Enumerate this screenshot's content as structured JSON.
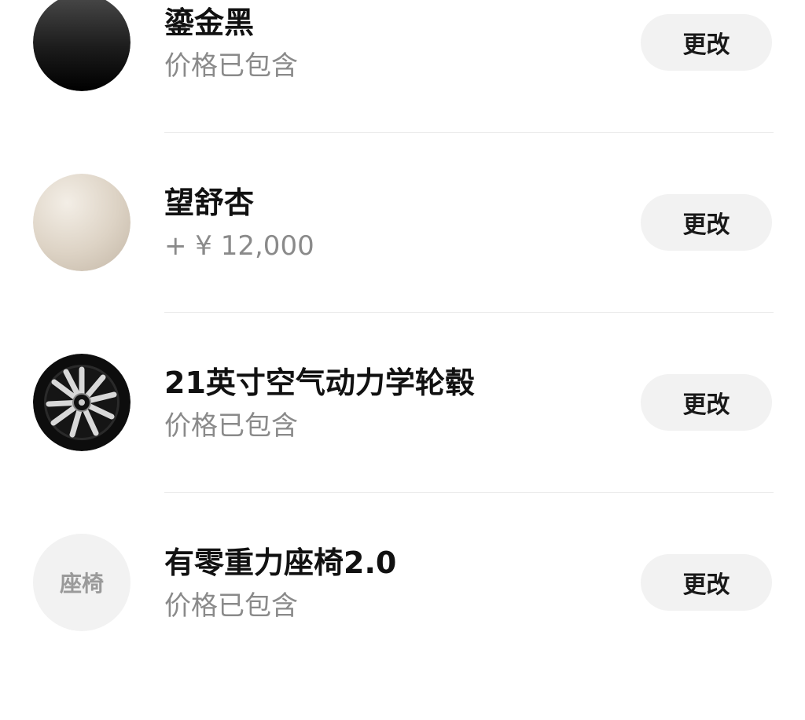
{
  "options": [
    {
      "swatch": "black-color-swatch",
      "title": "鎏金黑",
      "subtitle": "价格已包含",
      "button_label": "更改"
    },
    {
      "swatch": "apricot-color-swatch",
      "title": "望舒杏",
      "subtitle": "+ ¥ 12,000",
      "button_label": "更改"
    },
    {
      "swatch": "wheel-icon",
      "title": "21英寸空气动力学轮毂",
      "subtitle": "价格已包含",
      "button_label": "更改"
    },
    {
      "swatch": "seat-placeholder-icon",
      "swatch_label": "座椅",
      "title": "有零重力座椅2.0",
      "subtitle": "价格已包含",
      "button_label": "更改"
    }
  ],
  "colors": {
    "title": "#111111",
    "subtitle": "#8a8a8a",
    "button_bg": "#f2f2f2",
    "divider": "#ececec"
  }
}
